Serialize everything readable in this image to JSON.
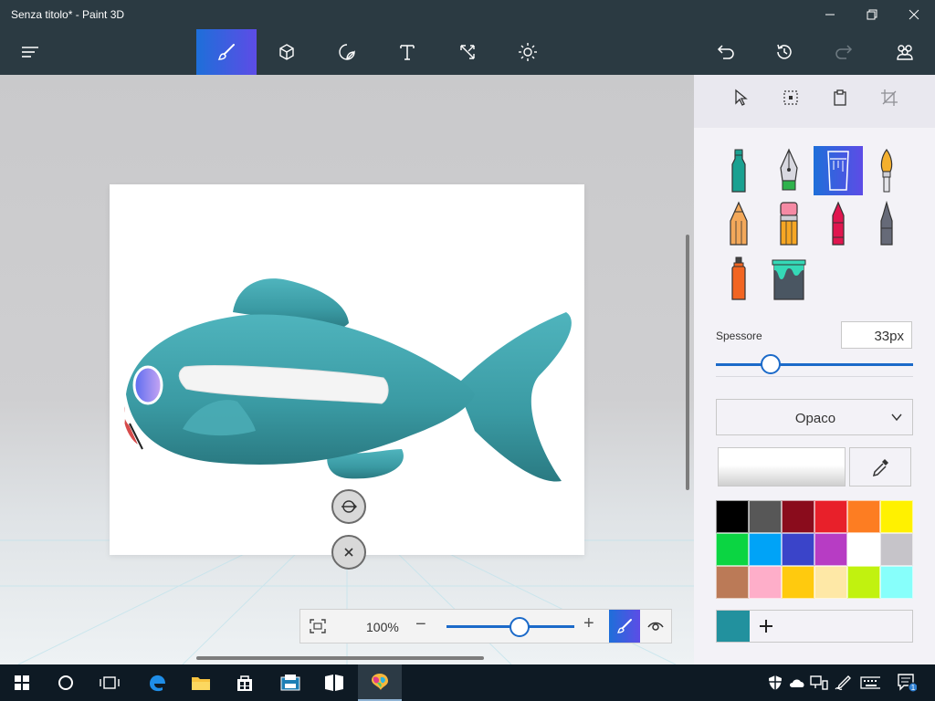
{
  "window": {
    "title": "Senza titolo* - Paint 3D"
  },
  "toolbar": {
    "tools": [
      "menu-icon",
      "brush-icon",
      "cube-icon",
      "sticker-icon",
      "text-icon",
      "canvas-icon",
      "effects-icon"
    ],
    "active_tool": "brush-icon",
    "actions": [
      "undo-icon",
      "history-icon",
      "redo-icon",
      "community-icon"
    ]
  },
  "zoom": {
    "value": "100%",
    "level_fraction": 0.5
  },
  "panel": {
    "thickness_label": "Spessore",
    "thickness_value": "33px",
    "thickness_fraction": 0.28,
    "finish_value": "Opaco",
    "palette": [
      "#000000",
      "#575757",
      "#8a0c1c",
      "#e8202a",
      "#fd7d22",
      "#fff100",
      "#0bd542",
      "#00a3f7",
      "#3a44c9",
      "#b73cc4",
      "#ffffff",
      "#c6c4c9",
      "#bb7a57",
      "#feaec9",
      "#ffca0e",
      "#fee8a6",
      "#c1f20f",
      "#87fffb"
    ],
    "custom_color": "#22919e",
    "active_brush": "calligraphy-icon"
  },
  "colors": {
    "accent": "#1e6fd9",
    "accent2": "#5d4ce6",
    "fish": "#3a9aa3"
  }
}
